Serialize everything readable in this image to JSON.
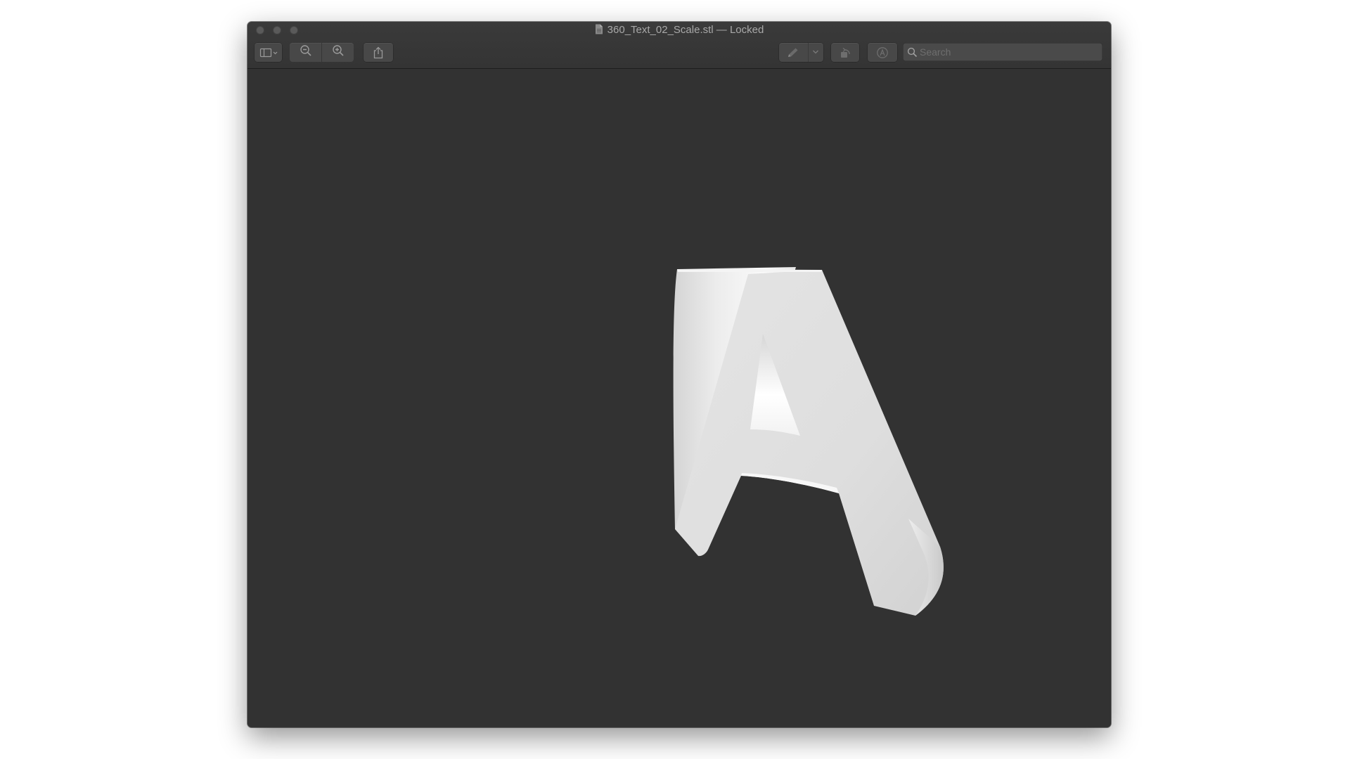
{
  "window": {
    "title": "360_Text_02_Scale.stl — Locked",
    "accent_color": "#323232"
  },
  "toolbar": {
    "sidebar_toggle_icon": "sidebar-icon",
    "zoom_out_icon": "zoom-out-icon",
    "zoom_in_icon": "zoom-in-icon",
    "share_icon": "share-icon",
    "markup_icon": "pen-icon",
    "rotate_icon": "rotate-icon",
    "annotate_icon": "markup-circle-icon"
  },
  "search": {
    "placeholder": "Search",
    "value": ""
  },
  "model": {
    "glyph": "A",
    "surface_color": "#dedede"
  }
}
